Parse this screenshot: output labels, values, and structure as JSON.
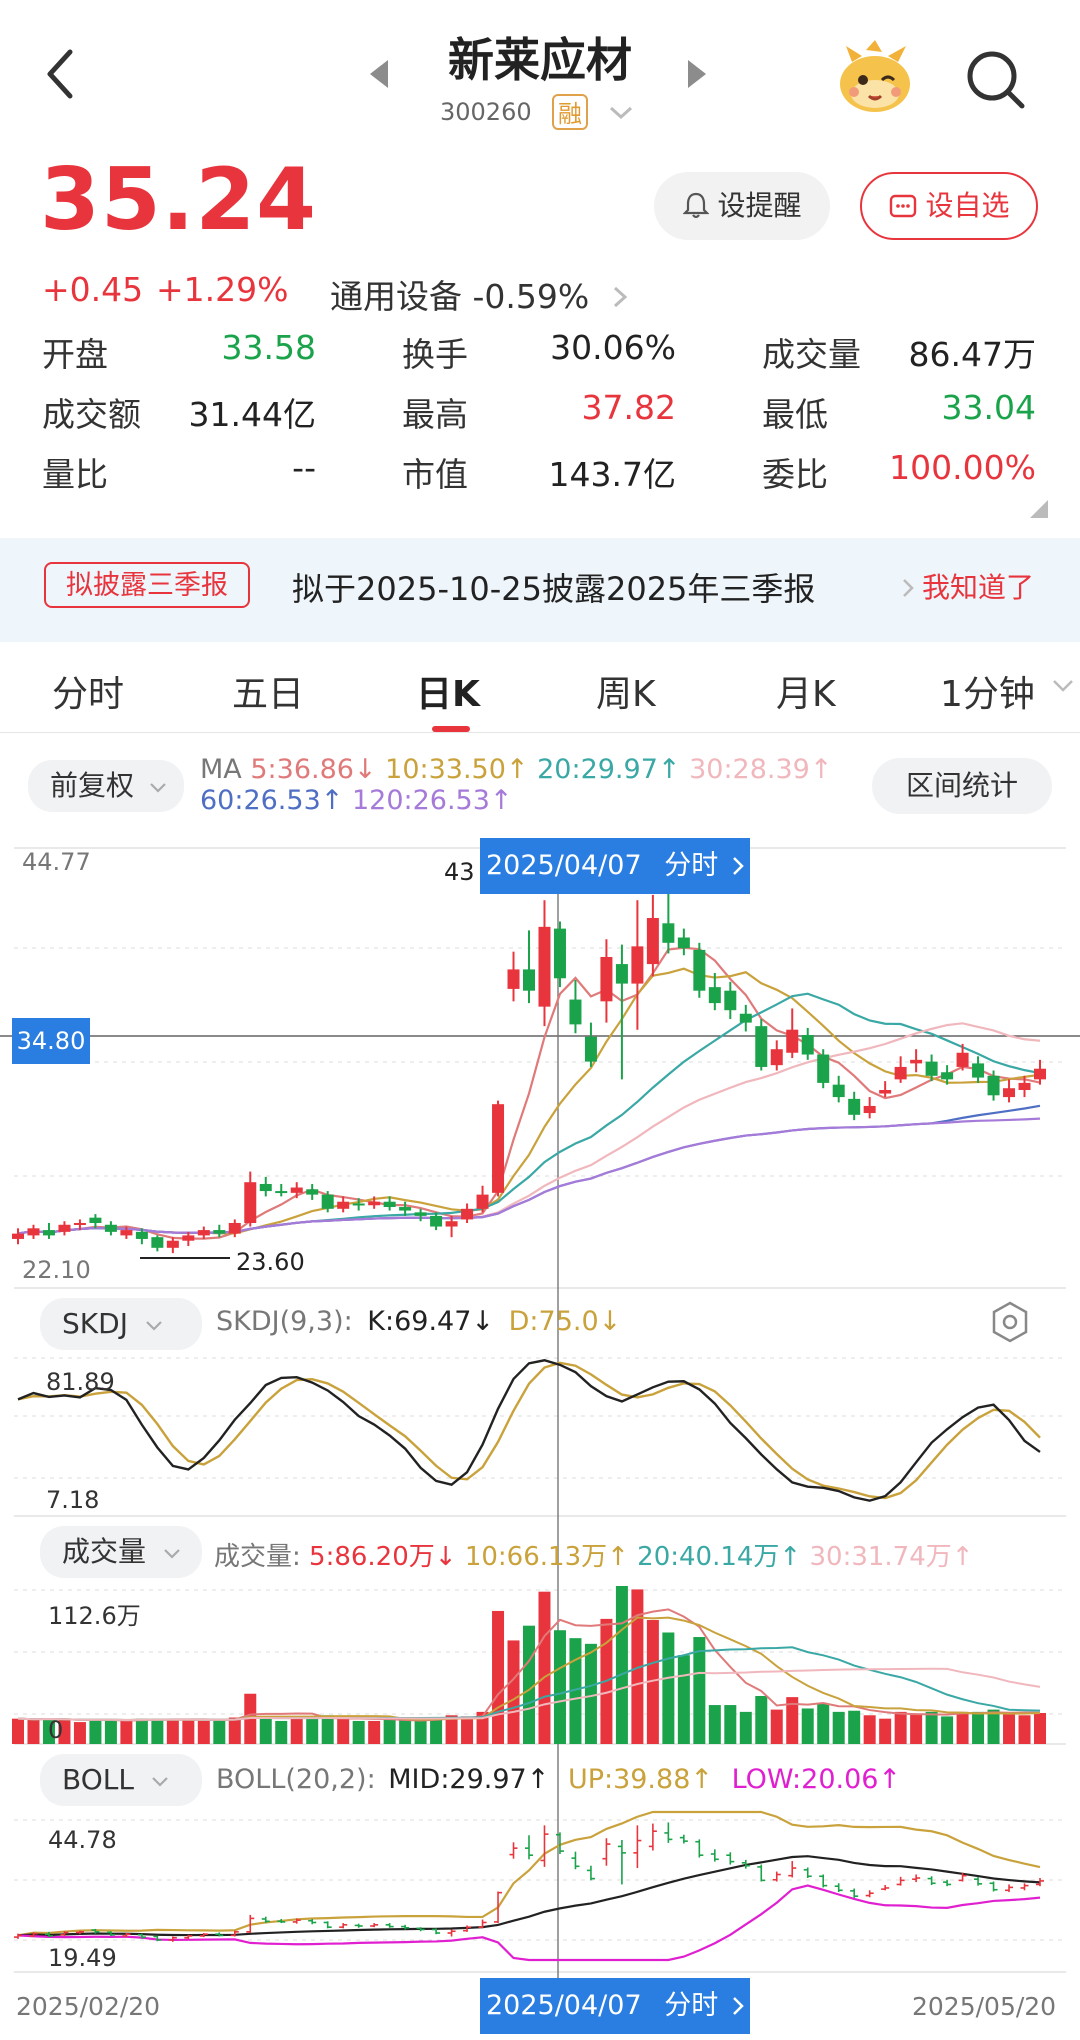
{
  "header": {
    "title": "新莱应材",
    "code": "300260",
    "margin_badge": "融"
  },
  "quote": {
    "price": "35.24",
    "change": "+0.45",
    "change_pct": "+1.29%",
    "sector": "通用设备",
    "sector_change": "-0.59%",
    "remind_label": "设提醒",
    "watch_label": "设自选"
  },
  "stats": [
    {
      "label": "开盘",
      "value": "33.58",
      "color": "#1aa34a"
    },
    {
      "label": "换手",
      "value": "30.06%",
      "color": "#222222"
    },
    {
      "label": "成交量",
      "value": "86.47万",
      "color": "#222222"
    },
    {
      "label": "成交额",
      "value": "31.44亿",
      "color": "#222222"
    },
    {
      "label": "最高",
      "value": "37.82",
      "color": "#e8353d"
    },
    {
      "label": "最低",
      "value": "33.04",
      "color": "#1aa34a"
    },
    {
      "label": "量比",
      "value": "--",
      "color": "#222222"
    },
    {
      "label": "市值",
      "value": "143.7亿",
      "color": "#222222"
    },
    {
      "label": "委比",
      "value": "100.00%",
      "color": "#e8353d"
    }
  ],
  "notice": {
    "tag": "拟披露三季报",
    "text": "拟于2025-10-25披露2025年三季报",
    "action": "我知道了"
  },
  "tabs": [
    "分时",
    "五日",
    "日K",
    "周K",
    "月K",
    "1分钟"
  ],
  "active_tab": "日K",
  "kline": {
    "adjust_label": "前复权",
    "interval_stats": "区间统计",
    "ma_prefix": "MA",
    "ma": [
      {
        "text": "5:36.86↓",
        "color": "#e07a7a"
      },
      {
        "text": "10:33.50↑",
        "color": "#c9a23c"
      },
      {
        "text": "20:29.97↑",
        "color": "#3aa8a5"
      },
      {
        "text": "30:28.39↑",
        "color": "#f0b7bd"
      },
      {
        "text": "60:26.53↑",
        "color": "#4f6fc4"
      },
      {
        "text": "120:26.53↑",
        "color": "#a67ad8"
      }
    ],
    "y_top": "44.77",
    "y_bottom": "22.10",
    "crosshair_price": "34.80",
    "crosshair_date": "2025/04/07",
    "crosshair_link": "分时",
    "high_marker": "43",
    "low_marker": "23.60"
  },
  "skdj": {
    "label": "SKDJ",
    "params": "SKDJ(9,3):",
    "k": "K:69.47↓",
    "d": "D:75.0↓",
    "y_top": "81.89",
    "y_bottom": "7.18"
  },
  "volume": {
    "label": "成交量",
    "prefix": "成交量:",
    "ma": [
      {
        "text": "5:86.20万↓",
        "color": "#e8353d"
      },
      {
        "text": "10:66.13万↑",
        "color": "#c9a23c"
      },
      {
        "text": "20:40.14万↑",
        "color": "#3aa8a5"
      },
      {
        "text": "30:31.74万↑",
        "color": "#f0b7bd"
      }
    ],
    "y_top": "112.6万",
    "y_bottom": "0"
  },
  "boll": {
    "label": "BOLL",
    "params": "BOLL(20,2):",
    "mid": "MID:29.97↑",
    "up": "UP:39.88↑",
    "low": "LOW:20.06↑",
    "y_top": "44.78",
    "y_bottom": "19.49"
  },
  "dates": {
    "start": "2025/02/20",
    "end": "2025/05/20"
  },
  "chart_data": {
    "type": "candlestick",
    "dates_range": [
      "2025/02/20",
      "2025/05/20"
    ],
    "ylim": [
      22.1,
      44.77
    ],
    "candles": [
      {
        "o": 23.4,
        "c": 23.7,
        "h": 24.0,
        "l": 23.1
      },
      {
        "o": 23.6,
        "c": 24.0,
        "h": 24.2,
        "l": 23.4
      },
      {
        "o": 23.9,
        "c": 23.6,
        "h": 24.3,
        "l": 23.4
      },
      {
        "o": 23.8,
        "c": 24.2,
        "h": 24.4,
        "l": 23.6
      },
      {
        "o": 24.2,
        "c": 24.3,
        "h": 24.5,
        "l": 23.9
      },
      {
        "o": 24.6,
        "c": 24.3,
        "h": 24.8,
        "l": 24.0
      },
      {
        "o": 24.2,
        "c": 23.8,
        "h": 24.4,
        "l": 23.6
      },
      {
        "o": 23.6,
        "c": 23.9,
        "h": 24.1,
        "l": 23.4
      },
      {
        "o": 23.8,
        "c": 23.4,
        "h": 24.0,
        "l": 23.1
      },
      {
        "o": 23.5,
        "c": 22.9,
        "h": 23.6,
        "l": 22.7
      },
      {
        "o": 22.9,
        "c": 23.3,
        "h": 23.5,
        "l": 22.6
      },
      {
        "o": 23.3,
        "c": 23.6,
        "h": 23.8,
        "l": 23.0
      },
      {
        "o": 23.6,
        "c": 23.9,
        "h": 24.1,
        "l": 23.4
      },
      {
        "o": 23.9,
        "c": 23.7,
        "h": 24.2,
        "l": 23.5
      },
      {
        "o": 23.7,
        "c": 24.3,
        "h": 24.5,
        "l": 23.5
      },
      {
        "o": 24.3,
        "c": 26.6,
        "h": 27.2,
        "l": 24.1
      },
      {
        "o": 26.5,
        "c": 26.1,
        "h": 26.9,
        "l": 25.8
      },
      {
        "o": 26.1,
        "c": 26.0,
        "h": 26.5,
        "l": 25.8
      },
      {
        "o": 26.0,
        "c": 26.3,
        "h": 26.6,
        "l": 25.7
      },
      {
        "o": 26.2,
        "c": 25.9,
        "h": 26.5,
        "l": 25.6
      },
      {
        "o": 25.9,
        "c": 25.1,
        "h": 26.1,
        "l": 24.9
      },
      {
        "o": 25.1,
        "c": 25.5,
        "h": 25.8,
        "l": 24.9
      },
      {
        "o": 25.4,
        "c": 25.3,
        "h": 25.7,
        "l": 25.0
      },
      {
        "o": 25.3,
        "c": 25.5,
        "h": 25.8,
        "l": 25.1
      },
      {
        "o": 25.5,
        "c": 25.2,
        "h": 25.8,
        "l": 25.0
      },
      {
        "o": 25.2,
        "c": 25.0,
        "h": 25.5,
        "l": 24.7
      },
      {
        "o": 24.9,
        "c": 24.7,
        "h": 25.1,
        "l": 24.4
      },
      {
        "o": 24.7,
        "c": 24.1,
        "h": 24.9,
        "l": 23.9
      },
      {
        "o": 24.1,
        "c": 24.4,
        "h": 24.7,
        "l": 23.5
      },
      {
        "o": 24.5,
        "c": 25.1,
        "h": 25.4,
        "l": 24.3
      },
      {
        "o": 25.1,
        "c": 25.9,
        "h": 26.4,
        "l": 24.9
      },
      {
        "o": 26.0,
        "c": 31.0,
        "h": 31.2,
        "l": 25.8
      },
      {
        "o": 37.5,
        "c": 38.6,
        "h": 39.6,
        "l": 36.8
      },
      {
        "o": 38.6,
        "c": 37.4,
        "h": 40.8,
        "l": 36.7
      },
      {
        "o": 36.5,
        "c": 41.0,
        "h": 42.5,
        "l": 35.4
      },
      {
        "o": 40.9,
        "c": 38.1,
        "h": 41.3,
        "l": 37.6
      },
      {
        "o": 36.9,
        "c": 35.5,
        "h": 38.0,
        "l": 35.0
      },
      {
        "o": 34.8,
        "c": 33.4,
        "h": 35.6,
        "l": 33.1
      },
      {
        "o": 36.8,
        "c": 39.3,
        "h": 40.3,
        "l": 35.6
      },
      {
        "o": 38.9,
        "c": 37.8,
        "h": 40.0,
        "l": 32.4
      },
      {
        "o": 37.8,
        "c": 39.9,
        "h": 42.5,
        "l": 35.2
      },
      {
        "o": 38.9,
        "c": 41.5,
        "h": 42.8,
        "l": 38.2
      },
      {
        "o": 41.2,
        "c": 40.1,
        "h": 43.0,
        "l": 39.5
      },
      {
        "o": 40.4,
        "c": 39.8,
        "h": 40.9,
        "l": 39.4
      },
      {
        "o": 39.7,
        "c": 37.4,
        "h": 40.1,
        "l": 37.0
      },
      {
        "o": 37.6,
        "c": 36.7,
        "h": 38.4,
        "l": 36.3
      },
      {
        "o": 37.4,
        "c": 36.3,
        "h": 37.9,
        "l": 35.8
      },
      {
        "o": 36.1,
        "c": 35.6,
        "h": 36.6,
        "l": 35.1
      },
      {
        "o": 35.4,
        "c": 33.1,
        "h": 35.8,
        "l": 32.9
      },
      {
        "o": 33.2,
        "c": 34.1,
        "h": 34.6,
        "l": 32.9
      },
      {
        "o": 33.9,
        "c": 35.2,
        "h": 36.4,
        "l": 33.6
      },
      {
        "o": 34.9,
        "c": 33.8,
        "h": 35.3,
        "l": 33.5
      },
      {
        "o": 33.8,
        "c": 32.2,
        "h": 34.1,
        "l": 31.9
      },
      {
        "o": 32.1,
        "c": 31.4,
        "h": 32.6,
        "l": 31.1
      },
      {
        "o": 31.3,
        "c": 30.4,
        "h": 31.7,
        "l": 30.1
      },
      {
        "o": 30.5,
        "c": 30.9,
        "h": 31.4,
        "l": 30.2
      },
      {
        "o": 31.6,
        "c": 31.8,
        "h": 32.3,
        "l": 31.4
      },
      {
        "o": 32.4,
        "c": 33.1,
        "h": 33.7,
        "l": 32.2
      },
      {
        "o": 33.3,
        "c": 33.5,
        "h": 34.1,
        "l": 32.8
      },
      {
        "o": 33.4,
        "c": 32.6,
        "h": 33.8,
        "l": 32.3
      },
      {
        "o": 32.8,
        "c": 32.4,
        "h": 33.2,
        "l": 32.1
      },
      {
        "o": 33.1,
        "c": 33.9,
        "h": 34.4,
        "l": 32.9
      },
      {
        "o": 33.3,
        "c": 32.5,
        "h": 33.7,
        "l": 32.2
      },
      {
        "o": 32.6,
        "c": 31.5,
        "h": 32.9,
        "l": 31.2
      },
      {
        "o": 31.4,
        "c": 31.9,
        "h": 32.4,
        "l": 31.1
      },
      {
        "o": 31.8,
        "c": 32.2,
        "h": 32.6,
        "l": 31.4
      },
      {
        "o": 32.4,
        "c": 33.0,
        "h": 33.5,
        "l": 32.1
      }
    ]
  }
}
